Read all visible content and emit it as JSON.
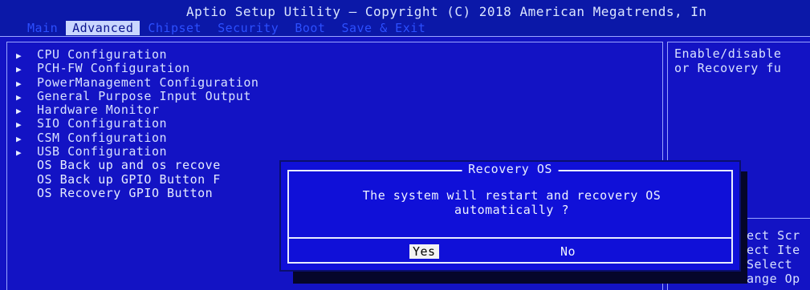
{
  "header": {
    "title": "Aptio Setup Utility – Copyright (C) 2018 American Megatrends, In",
    "tabs": [
      {
        "label": "Main",
        "active": false
      },
      {
        "label": "Advanced",
        "active": true
      },
      {
        "label": "Chipset",
        "active": false
      },
      {
        "label": "Security",
        "active": false
      },
      {
        "label": "Boot",
        "active": false
      },
      {
        "label": "Save & Exit",
        "active": false
      }
    ]
  },
  "menu": {
    "items": [
      {
        "label": "CPU Configuration",
        "submenu": true
      },
      {
        "label": "PCH-FW Configuration",
        "submenu": true
      },
      {
        "label": "PowerManagement Configuration",
        "submenu": true
      },
      {
        "label": "General Purpose Input Output",
        "submenu": true
      },
      {
        "label": "Hardware Monitor",
        "submenu": true
      },
      {
        "label": "SIO Configuration",
        "submenu": true
      },
      {
        "label": "CSM Configuration",
        "submenu": true
      },
      {
        "label": "USB Configuration",
        "submenu": true
      },
      {
        "label": "OS Back up and os recove",
        "submenu": false
      },
      {
        "label": "OS Back up GPIO Button F",
        "submenu": false
      },
      {
        "label": "OS Recovery GPIO Button",
        "submenu": false
      }
    ],
    "arrow_glyph": "▶"
  },
  "help": {
    "line1": "Enable/disable",
    "line2": "or Recovery fu"
  },
  "keys": {
    "line1": "ect Scr",
    "line2": "ect Ite",
    "line3": "Select",
    "line4": "ange Op"
  },
  "dialog": {
    "title": "Recovery OS",
    "message_line1": "The system will restart and recovery OS",
    "message_line2": "automatically ?",
    "yes_label": "Yes",
    "no_label": "No",
    "selected": "yes"
  },
  "colors": {
    "background": "#1313c4",
    "dialog": "#1010d8",
    "text": "#d8e1ff",
    "active_tab": "#c9d6ff",
    "selected_button": "#f2f2f2"
  }
}
